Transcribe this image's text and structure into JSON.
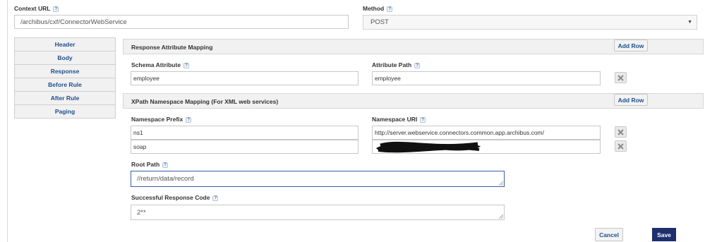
{
  "context_url": {
    "label": "Context URL",
    "value": "/archibus/cxf/ConnectorWebService"
  },
  "method": {
    "label": "Method",
    "value": "POST"
  },
  "help_glyph": "?",
  "sidebar": {
    "items": [
      {
        "label": "Header"
      },
      {
        "label": "Body"
      },
      {
        "label": "Response"
      },
      {
        "label": "Before Rule"
      },
      {
        "label": "After Rule"
      },
      {
        "label": "Paging"
      }
    ]
  },
  "response_mapping": {
    "title": "Response Attribute Mapping",
    "add_row_label": "Add Row",
    "schema_attribute_label": "Schema Attribute",
    "attribute_path_label": "Attribute Path",
    "row": {
      "schema_attribute": "employee",
      "attribute_path": "employee"
    }
  },
  "xpath_mapping": {
    "title": "XPath Namespace Mapping (For XML web services)",
    "add_row_label": "Add Row",
    "prefix_label": "Namespace Prefix",
    "uri_label": "Namespace URI",
    "rows": [
      {
        "prefix": "ns1",
        "uri": "http://server.webservice.connectors.common.app.archibus.com/"
      },
      {
        "prefix": "soap",
        "uri": ""
      }
    ]
  },
  "root_path": {
    "label": "Root Path",
    "value": "//return/data/record"
  },
  "success_code": {
    "label": "Successful Response Code",
    "value": "2**"
  },
  "actions": {
    "cancel_label": "Cancel",
    "save_label": "Save"
  },
  "colors": {
    "accent": "#1f4f8e",
    "save_bg": "#1f2f6e",
    "bar_bg": "#f1f1f1"
  }
}
